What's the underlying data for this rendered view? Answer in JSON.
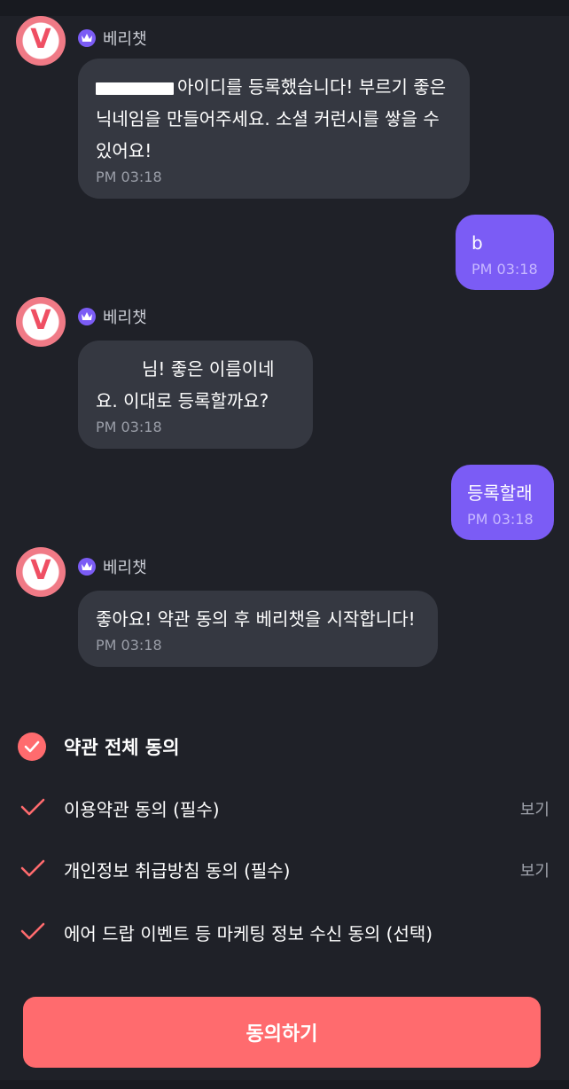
{
  "bot": {
    "name": "베리챗",
    "avatar_letter": "V"
  },
  "messages": [
    {
      "id": "m1",
      "from": "bot",
      "text": "아이디를 등록했습니다! 부르기 좋은 닉네임을 만들어주세요. 소셜 커런시를 쌓을 수 있어요!",
      "time": "PM 03:18"
    },
    {
      "id": "m2",
      "from": "user",
      "text": "b",
      "time": "PM 03:18"
    },
    {
      "id": "m3",
      "from": "bot",
      "text": "님! 좋은 이름이네요. 이대로 등록할까요?",
      "time": "PM 03:18"
    },
    {
      "id": "m4",
      "from": "user",
      "text": "등록할래",
      "time": "PM 03:18"
    },
    {
      "id": "m5",
      "from": "bot",
      "text": "좋아요! 약관 동의 후 베리챗을 시작합니다!",
      "time": "PM 03:18"
    }
  ],
  "consent": {
    "all_label": "약관 전체 동의",
    "items": [
      {
        "label": "이용약관 동의 (필수)",
        "link": "보기",
        "checked": true
      },
      {
        "label": "개인정보 취급방침 동의 (필수)",
        "link": "보기",
        "checked": true
      },
      {
        "label": "에어 드랍 이벤트 등 마케팅 정보 수신 동의 (선택)",
        "checked": true
      }
    ],
    "submit_label": "동의하기"
  },
  "colors": {
    "background": "#1f2128",
    "bot_bubble": "#353841",
    "user_bubble": "#7b5cf5",
    "accent": "#ff6b6e",
    "crown": "#7b5cf5"
  }
}
